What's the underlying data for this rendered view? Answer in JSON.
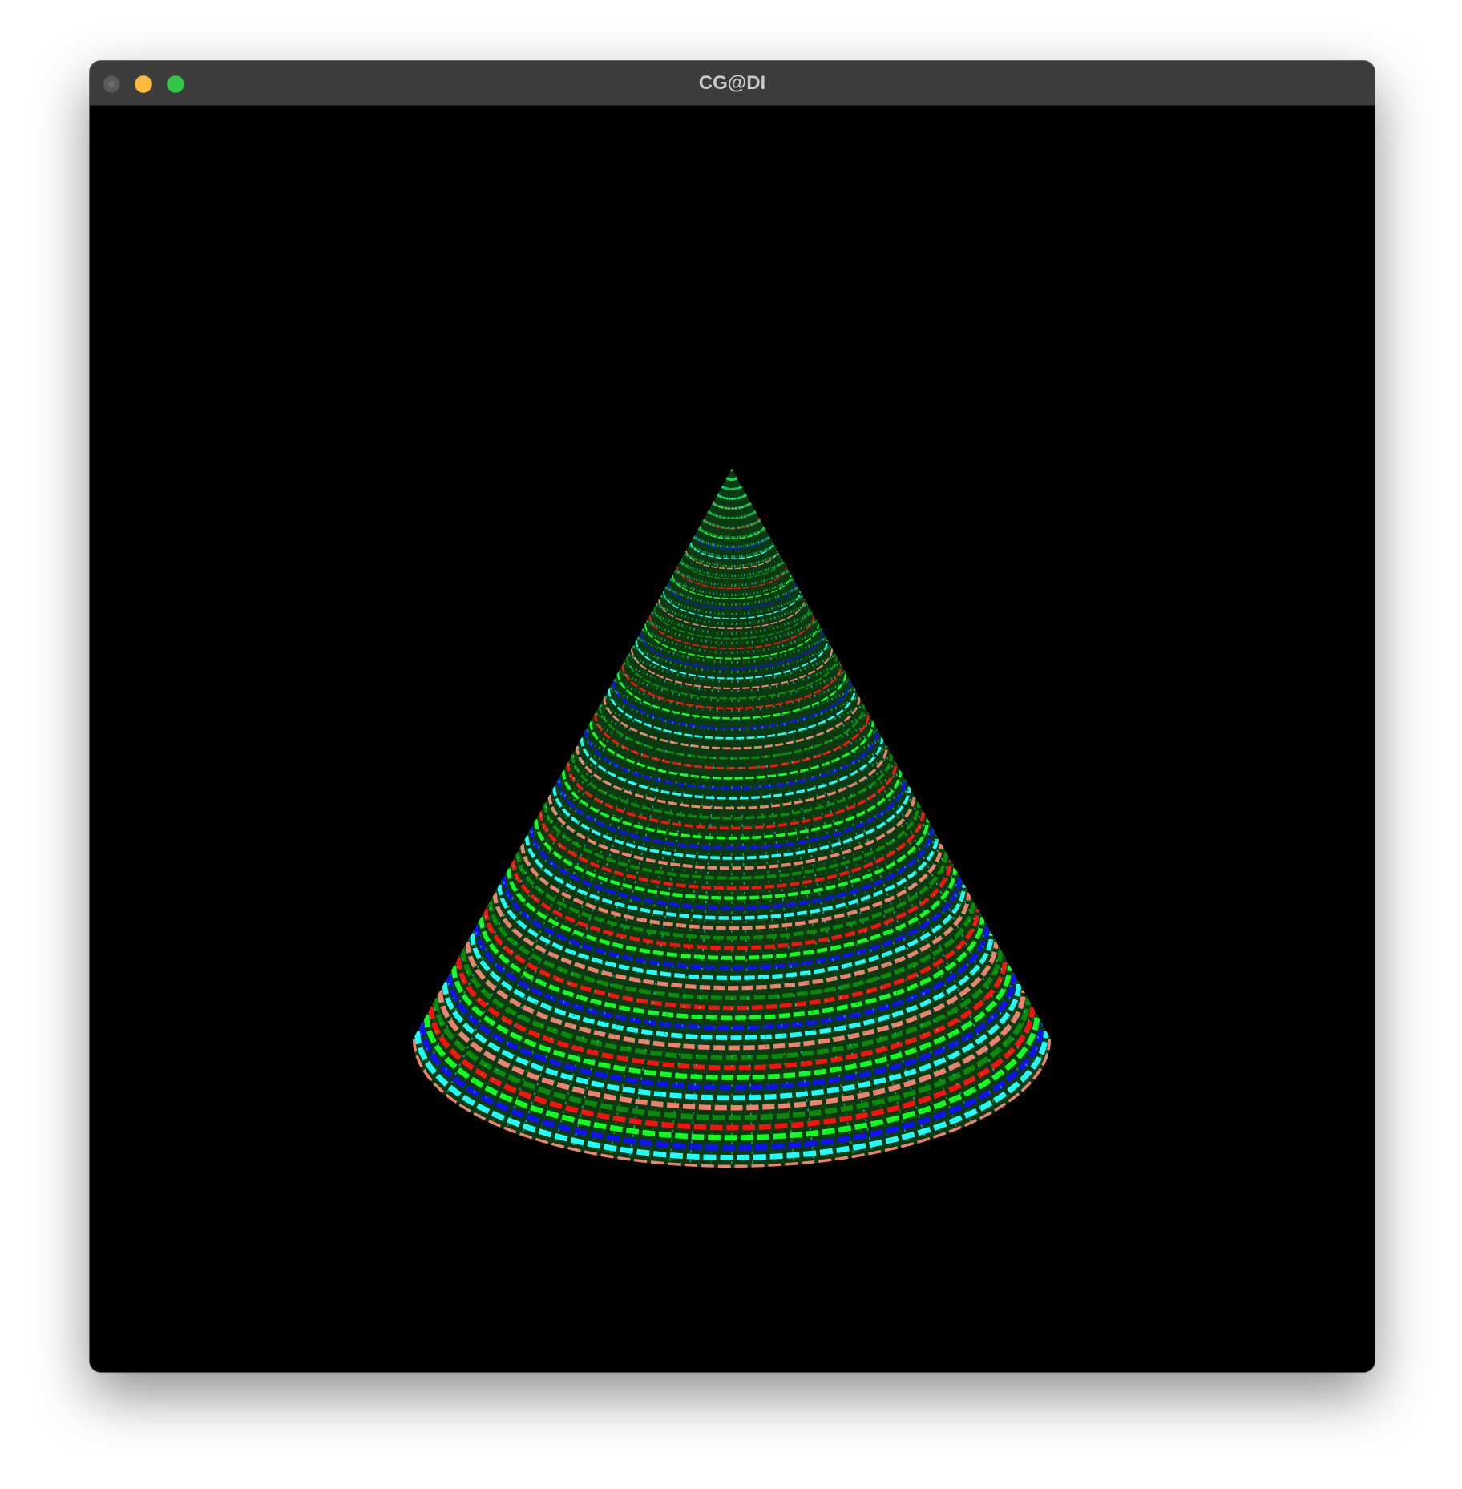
{
  "window": {
    "title": "CG@DI",
    "controls": [
      "close",
      "minimize",
      "zoom"
    ]
  },
  "viewport": {
    "background": "#000000",
    "scene": {
      "object": "cone",
      "stripe_colors": [
        "#ff1010",
        "#10ff20",
        "#1010ff",
        "#20ffff",
        "#f08070",
        "#0a8a0a"
      ]
    }
  }
}
